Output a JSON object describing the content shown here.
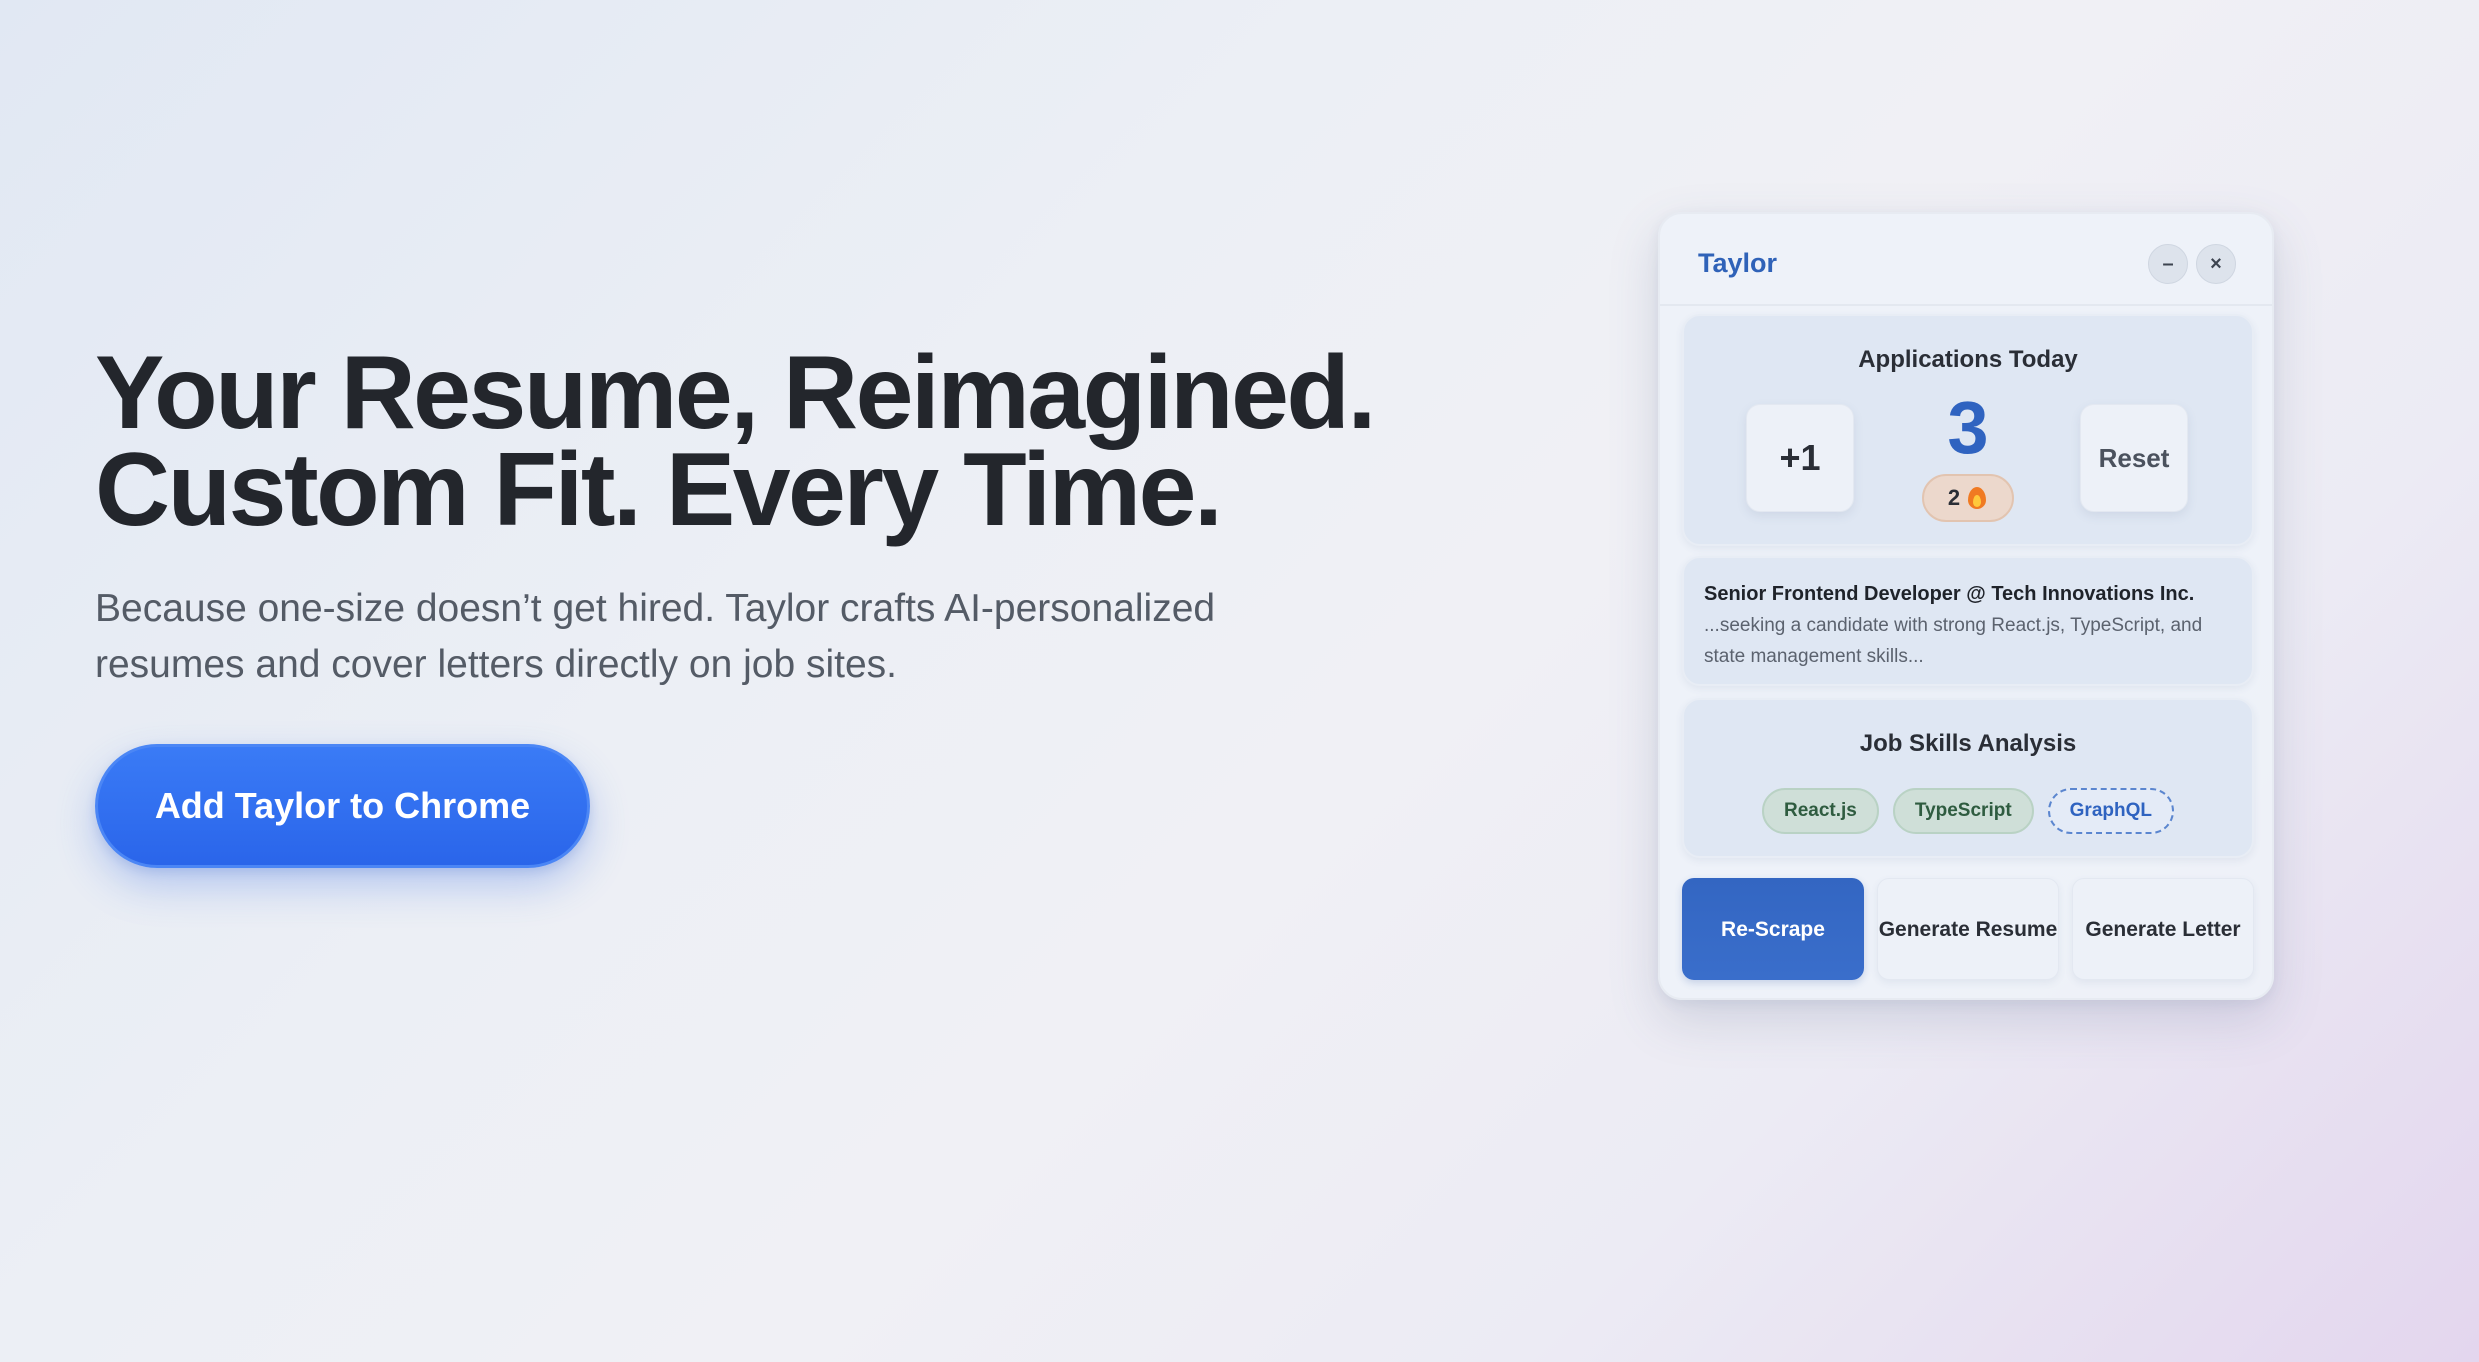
{
  "hero": {
    "headline_line1": "Your Resume, Reimagined.",
    "headline_line2": "Custom Fit. Every Time.",
    "subtext": "Because one-size doesn’t get hired. Taylor crafts AI-personalized resumes and cover letters directly on job sites.",
    "cta_label": "Add Taylor to Chrome"
  },
  "widget": {
    "title": "Taylor",
    "minimize_label": "–",
    "close_label": "×",
    "applications": {
      "title": "Applications Today",
      "increment_label": "+1",
      "count": "3",
      "reset_label": "Reset",
      "streak": "2"
    },
    "job": {
      "title": "Senior Frontend Developer @ Tech Innovations Inc.",
      "snippet": "...seeking a candidate with strong React.js, TypeScript, and state management skills..."
    },
    "skills": {
      "title": "Job Skills Analysis",
      "items": [
        {
          "label": "React.js",
          "status": "matched"
        },
        {
          "label": "TypeScript",
          "status": "matched"
        },
        {
          "label": "GraphQL",
          "status": "missing"
        }
      ]
    },
    "actions": {
      "rescrape": "Re-Scrape",
      "generate_resume": "Generate Resume",
      "generate_letter": "Generate Letter"
    }
  },
  "icons": {
    "streak": "fire-icon",
    "minimize": "minimize-icon",
    "close": "close-icon"
  },
  "colors": {
    "cta": "#2f6ff0",
    "brand_blue": "#2f62b8",
    "matched_chip": "#cfdfd8",
    "missing_chip_border": "#5b86cf"
  }
}
